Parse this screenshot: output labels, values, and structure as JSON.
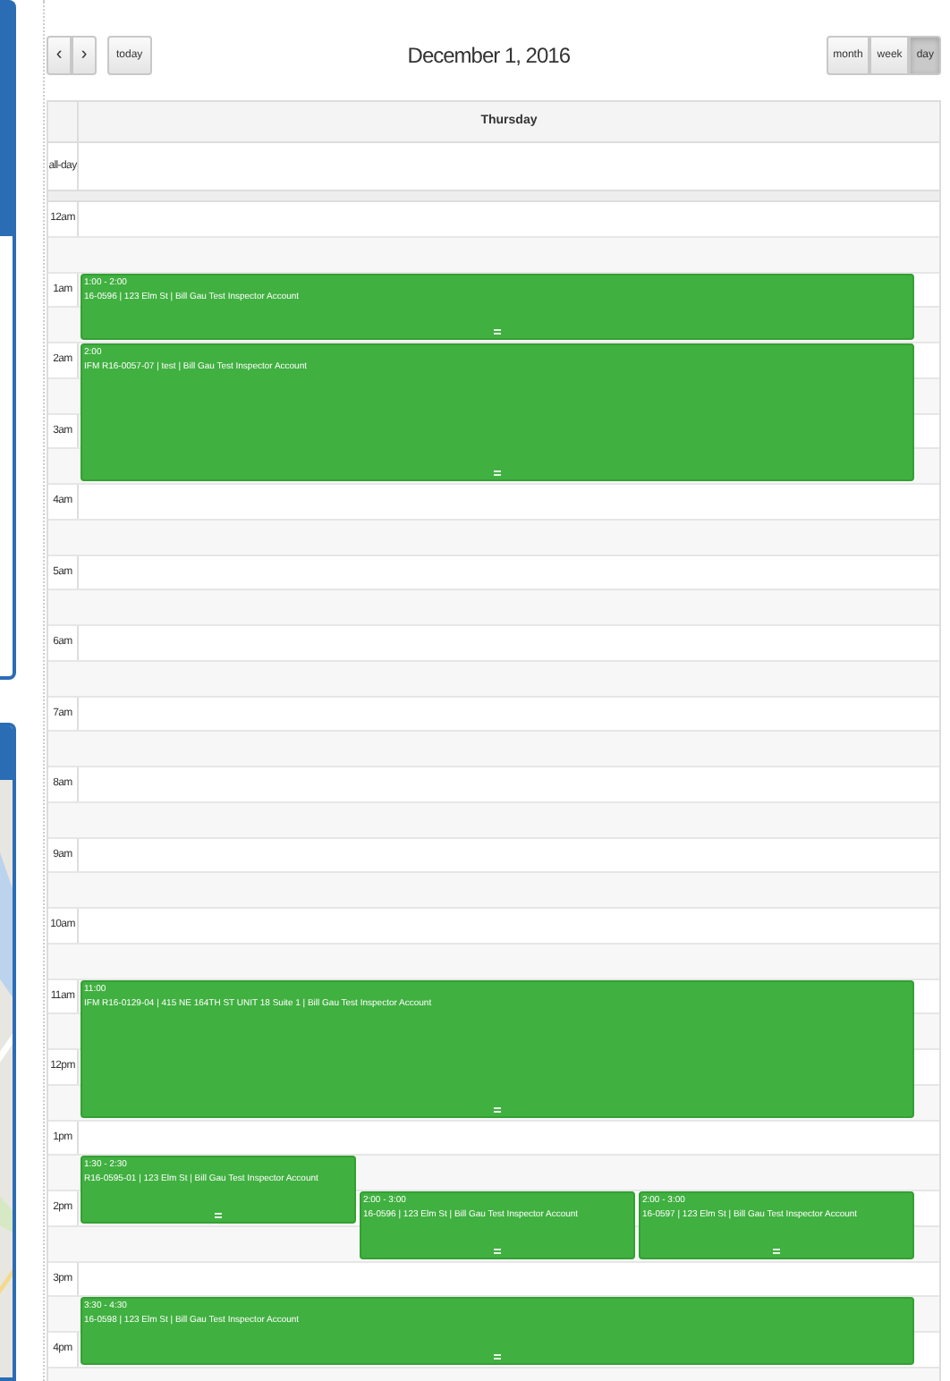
{
  "toolbar": {
    "prev": "‹",
    "next": "›",
    "today": "today",
    "title": "December 1, 2016",
    "views": [
      {
        "label": "month",
        "selected": false
      },
      {
        "label": "week",
        "selected": false
      },
      {
        "label": "day",
        "selected": true
      }
    ]
  },
  "day_header": "Thursday",
  "all_day_label": "all-day",
  "slots": [
    {
      "label": "12am"
    },
    {
      "label": "1am",
      "events": [
        {
          "time": "1:00 - 2:00",
          "title": "16-0596 | 123 Elm St | Bill Gau Test Inspector Account"
        }
      ]
    },
    {
      "label": "2am",
      "events": [
        {
          "time": "2:00",
          "title": "IFM R16-0057-07 | test | Bill Gau Test Inspector Account"
        }
      ]
    },
    {
      "label": "3am"
    },
    {
      "label": "4am"
    },
    {
      "label": "5am"
    },
    {
      "label": "6am"
    },
    {
      "label": "7am"
    },
    {
      "label": "8am"
    },
    {
      "label": "9am"
    },
    {
      "label": "10am"
    },
    {
      "label": "11am",
      "events": [
        {
          "time": "11:00",
          "title": "IFM R16-0129-04 | 415 NE 164TH ST UNIT 18 Suite 1 | Bill Gau Test Inspector Account"
        }
      ]
    },
    {
      "label": "12pm"
    },
    {
      "label": "1pm",
      "events": [
        {
          "time": "1:30 - 2:30",
          "title": "R16-0595-01 | 123 Elm St | Bill Gau Test Inspector Account"
        }
      ]
    },
    {
      "label": "2pm",
      "events": [
        {
          "time": "2:00 - 3:00",
          "title": "16-0596 | 123 Elm St | Bill Gau Test Inspector Account"
        },
        {
          "time": "2:00 - 3:00",
          "title": "16-0597 | 123 Elm St | Bill Gau Test Inspector Account"
        }
      ]
    },
    {
      "label": "3pm",
      "events": [
        {
          "time": "3:30 - 4:30",
          "title": "16-0598 | 123 Elm St | Bill Gau Test Inspector Account"
        }
      ]
    },
    {
      "label": "4pm"
    }
  ]
}
